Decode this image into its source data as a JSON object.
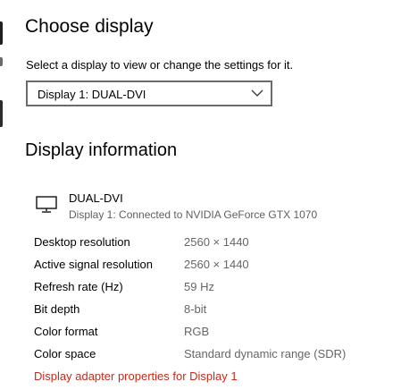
{
  "header": {
    "title": "Choose display",
    "instruction": "Select a display to view or change the settings for it."
  },
  "display_select": {
    "selected": "Display 1: DUAL-DVI",
    "icon": "chevron-down-icon"
  },
  "info_section": {
    "title": "Display information",
    "device": {
      "icon": "monitor-icon",
      "name": "DUAL-DVI",
      "description": "Display 1: Connected to NVIDIA GeForce GTX 1070"
    },
    "rows": [
      {
        "label": "Desktop resolution",
        "value": "2560 × 1440"
      },
      {
        "label": "Active signal resolution",
        "value": "2560 × 1440"
      },
      {
        "label": "Refresh rate (Hz)",
        "value": "59 Hz"
      },
      {
        "label": "Bit depth",
        "value": "8-bit"
      },
      {
        "label": "Color format",
        "value": "RGB"
      },
      {
        "label": "Color space",
        "value": "Standard dynamic range (SDR)"
      }
    ],
    "adapter_link": "Display adapter properties for Display 1"
  },
  "colors": {
    "link": "#c42b1c",
    "secondary_text": "#666666",
    "border": "#6b6b6b"
  }
}
